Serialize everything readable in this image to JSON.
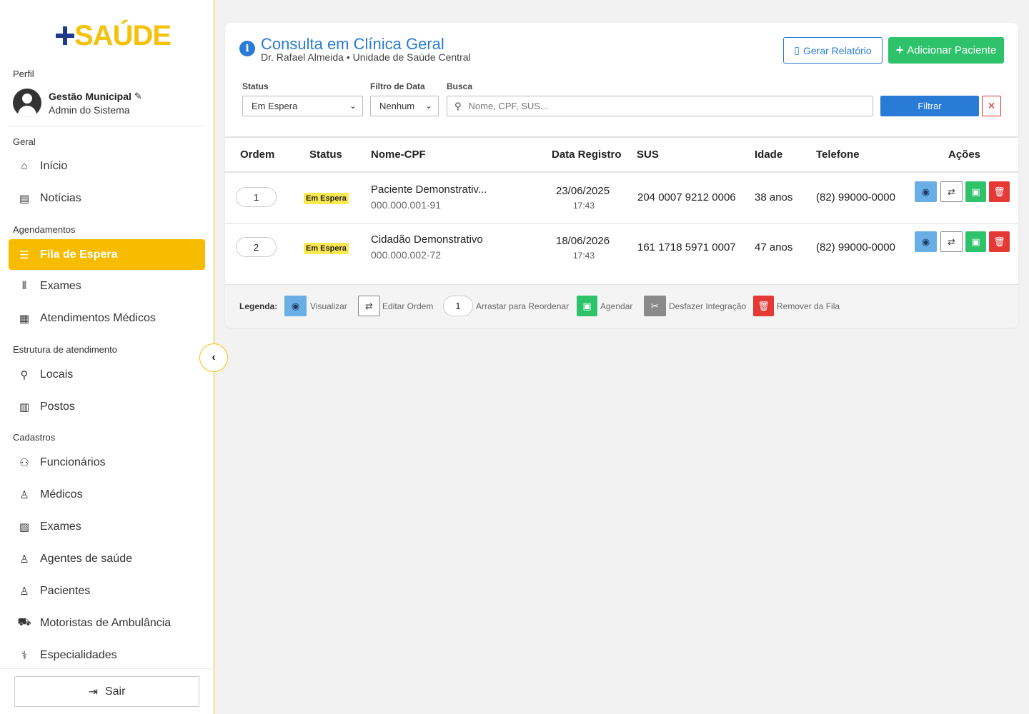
{
  "brand": {
    "plus": "+",
    "word": "SAÚDE"
  },
  "sidebar": {
    "profile_label": "Perfil",
    "profile_name": "Gestão Municipal",
    "profile_role": "Admin do Sistema",
    "sections": {
      "geral": "Geral",
      "agendamentos": "Agendamentos",
      "estrutura": "Estrutura de atendimento",
      "cadastros": "Cadastros"
    },
    "items": {
      "inicio": "Início",
      "noticias": "Notícias",
      "fila": "Fila de Espera",
      "exames": "Exames",
      "atendimentos": "Atendimentos Médicos",
      "locais": "Locais",
      "postos": "Postos",
      "funcionarios": "Funcionários",
      "medicos": "Médicos",
      "exames_cad": "Exames",
      "agentes": "Agentes de saúde",
      "pacientes": "Pacientes",
      "motoristas": "Motoristas de Ambulância",
      "especialidades": "Especialidades"
    },
    "logout": "Sair"
  },
  "card": {
    "title": "Consulta em Clínica Geral",
    "subtitle": "Dr. Rafael Almeida • Unidade de Saúde Central",
    "report_button": "Gerar Relatório",
    "add_button": "Adicionar Paciente"
  },
  "filters": {
    "status_label": "Status",
    "status_value": "Em Espera",
    "date_label": "Filtro de Data",
    "date_value": "Nenhum",
    "search_label": "Busca",
    "search_placeholder": "Nome, CPF, SUS...",
    "filter_button": "Filtrar"
  },
  "table": {
    "headers": [
      "Ordem",
      "Status",
      "Nome-CPF",
      "Data Registro",
      "SUS",
      "Idade",
      "Telefone",
      "Ações"
    ],
    "rows": [
      {
        "ordem": "1",
        "status": "Em Espera",
        "nome": "Paciente Demonstrativ...",
        "cpf": "000.000.001-91",
        "data": "23/06/2025",
        "hora": "17:43",
        "sus": "204 0007 9212 0006",
        "idade": "38 anos",
        "telefone": "(82) 99000-0000"
      },
      {
        "ordem": "2",
        "status": "Em Espera",
        "nome": "Cidadão Demonstrativo",
        "cpf": "000.000.002-72",
        "data": "18/06/2026",
        "hora": "17:43",
        "sus": "161 1718 5971 0007",
        "idade": "47 anos",
        "telefone": "(82) 99000-0000"
      }
    ]
  },
  "legend": {
    "title": "Legenda:",
    "visualizar": "Visualizar",
    "editar": "Editar Ordem",
    "arrastar_num": "1",
    "arrastar": "Arrastar para Reordenar",
    "agendar": "Agendar",
    "desfazer": "Desfazer Integração",
    "remover": "Remover da Fila"
  },
  "colors": {
    "accent": "#f7bc00",
    "primary": "#2a7bd5",
    "success": "#2ec36a",
    "danger": "#e53935"
  }
}
